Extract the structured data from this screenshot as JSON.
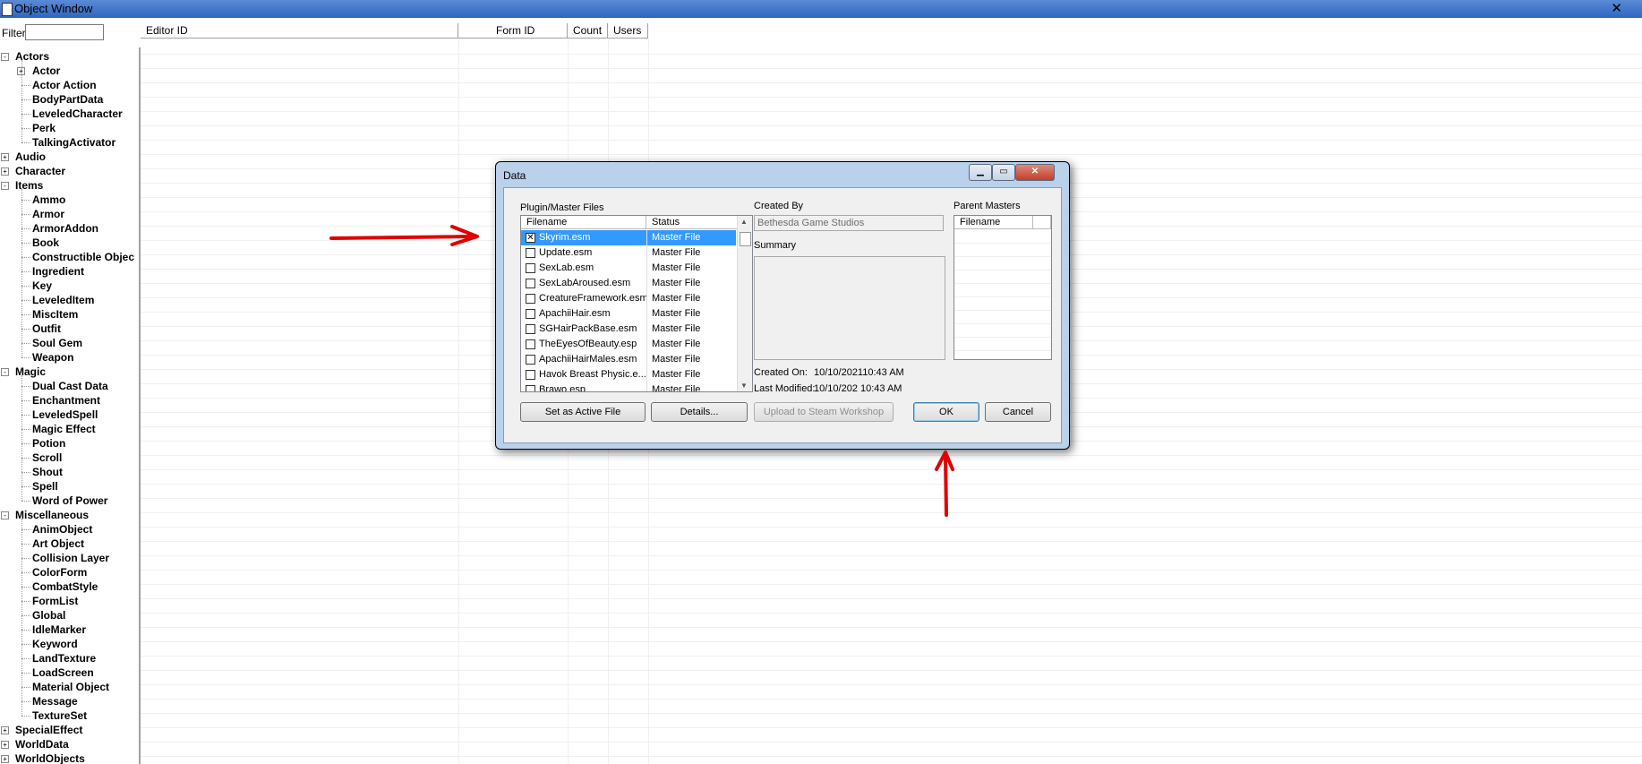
{
  "window": {
    "title": "Object Window"
  },
  "filter": {
    "label": "Filter",
    "value": ""
  },
  "columns": [
    "Editor ID",
    "Form ID",
    "Count",
    "Users"
  ],
  "tree": [
    {
      "label": "Actors",
      "level": 0,
      "exp": "-"
    },
    {
      "label": "Actor",
      "level": 1,
      "exp": "+"
    },
    {
      "label": "Actor Action",
      "level": 1
    },
    {
      "label": "BodyPartData",
      "level": 1
    },
    {
      "label": "LeveledCharacter",
      "level": 1
    },
    {
      "label": "Perk",
      "level": 1
    },
    {
      "label": "TalkingActivator",
      "level": 1
    },
    {
      "label": "Audio",
      "level": 0,
      "exp": "+"
    },
    {
      "label": "Character",
      "level": 0,
      "exp": "+"
    },
    {
      "label": "Items",
      "level": 0,
      "exp": "-"
    },
    {
      "label": "Ammo",
      "level": 1
    },
    {
      "label": "Armor",
      "level": 1
    },
    {
      "label": "ArmorAddon",
      "level": 1
    },
    {
      "label": "Book",
      "level": 1
    },
    {
      "label": "Constructible Objec",
      "level": 1
    },
    {
      "label": "Ingredient",
      "level": 1
    },
    {
      "label": "Key",
      "level": 1
    },
    {
      "label": "LeveledItem",
      "level": 1
    },
    {
      "label": "MiscItem",
      "level": 1
    },
    {
      "label": "Outfit",
      "level": 1
    },
    {
      "label": "Soul Gem",
      "level": 1
    },
    {
      "label": "Weapon",
      "level": 1
    },
    {
      "label": "Magic",
      "level": 0,
      "exp": "-"
    },
    {
      "label": "Dual Cast Data",
      "level": 1
    },
    {
      "label": "Enchantment",
      "level": 1
    },
    {
      "label": "LeveledSpell",
      "level": 1
    },
    {
      "label": "Magic Effect",
      "level": 1
    },
    {
      "label": "Potion",
      "level": 1
    },
    {
      "label": "Scroll",
      "level": 1
    },
    {
      "label": "Shout",
      "level": 1
    },
    {
      "label": "Spell",
      "level": 1
    },
    {
      "label": "Word of Power",
      "level": 1
    },
    {
      "label": "Miscellaneous",
      "level": 0,
      "exp": "-"
    },
    {
      "label": "AnimObject",
      "level": 1
    },
    {
      "label": "Art Object",
      "level": 1
    },
    {
      "label": "Collision Layer",
      "level": 1
    },
    {
      "label": "ColorForm",
      "level": 1
    },
    {
      "label": "CombatStyle",
      "level": 1
    },
    {
      "label": "FormList",
      "level": 1
    },
    {
      "label": "Global",
      "level": 1
    },
    {
      "label": "IdleMarker",
      "level": 1
    },
    {
      "label": "Keyword",
      "level": 1
    },
    {
      "label": "LandTexture",
      "level": 1
    },
    {
      "label": "LoadScreen",
      "level": 1
    },
    {
      "label": "Material Object",
      "level": 1
    },
    {
      "label": "Message",
      "level": 1
    },
    {
      "label": "TextureSet",
      "level": 1
    },
    {
      "label": "SpecialEffect",
      "level": 0,
      "exp": "+"
    },
    {
      "label": "WorldData",
      "level": 0,
      "exp": "+"
    },
    {
      "label": "WorldObjects",
      "level": 0,
      "exp": "+"
    }
  ],
  "dialog": {
    "title": "Data",
    "plugin_label": "Plugin/Master Files",
    "list_headers": {
      "filename": "Filename",
      "status": "Status"
    },
    "files": [
      {
        "name": "Skyrim.esm",
        "status": "Master File",
        "checked": true,
        "selected": true
      },
      {
        "name": "Update.esm",
        "status": "Master File"
      },
      {
        "name": "SexLab.esm",
        "status": "Master File"
      },
      {
        "name": "SexLabAroused.esm",
        "status": "Master File"
      },
      {
        "name": "CreatureFramework.esm",
        "status": "Master File"
      },
      {
        "name": "ApachiiHair.esm",
        "status": "Master File"
      },
      {
        "name": "SGHairPackBase.esm",
        "status": "Master File"
      },
      {
        "name": "TheEyesOfBeauty.esp",
        "status": "Master File"
      },
      {
        "name": "ApachiiHairMales.esm",
        "status": "Master File"
      },
      {
        "name": "Havok Breast Physic.e...",
        "status": "Master File"
      },
      {
        "name": "Brawo.esp",
        "status": "Master File"
      }
    ],
    "created_by_label": "Created By",
    "created_by": "Bethesda Game Studios",
    "summary_label": "Summary",
    "created_on_label": "Created On:",
    "created_on": "10/10/202110:43 AM",
    "last_modified_label": "Last Modified:",
    "last_modified": "10/10/202 10:43 AM",
    "parent_masters_label": "Parent Masters",
    "parent_masters_header": "Filename",
    "buttons": {
      "set_active": "Set as Active File",
      "details": "Details...",
      "upload": "Upload to Steam Workshop",
      "ok": "OK",
      "cancel": "Cancel"
    }
  },
  "colors": {
    "annotation": "#e00000",
    "selection": "#3399ff",
    "dialog_frame": "#b9d1ea"
  }
}
